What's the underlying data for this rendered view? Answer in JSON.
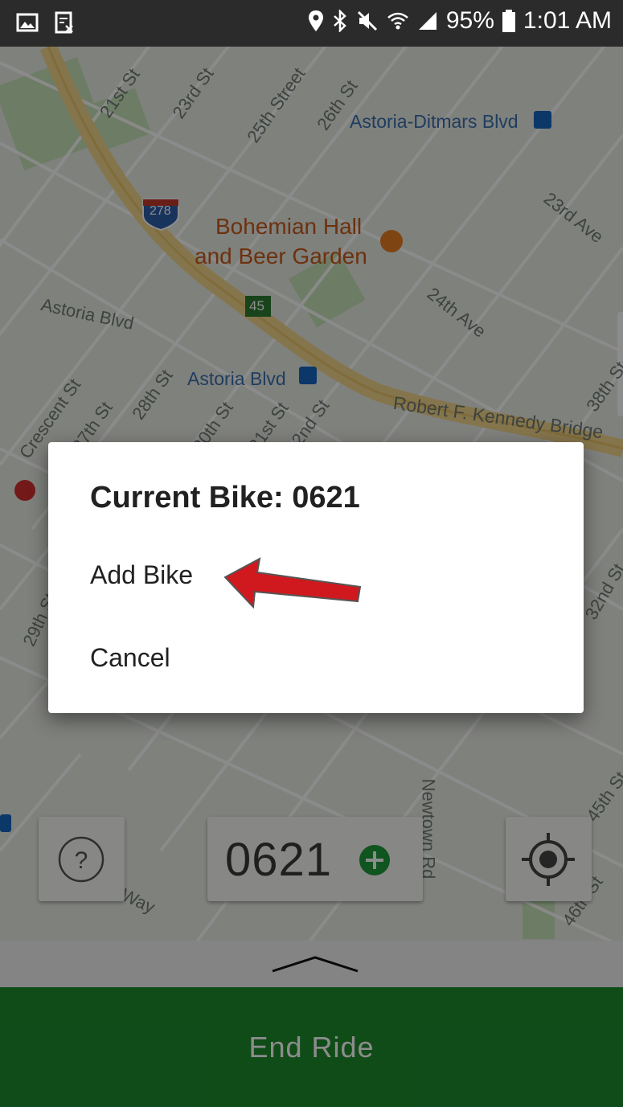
{
  "status_bar": {
    "battery": "95%",
    "time": "1:01 AM"
  },
  "map": {
    "labels": {
      "st21": "21st St",
      "st23": "23rd St",
      "street25": "25th Street",
      "st26": "26th St",
      "ditmars": "Astoria-Ditmars Blvd",
      "ave23": "23rd Ave",
      "interstate": "278",
      "bohemian_line1": "Bohemian Hall",
      "bohemian_line2": "and Beer Garden",
      "exit": "45",
      "astoria_blvd_road": "Astoria Blvd",
      "ave24": "24th Ave",
      "st38": "38th St",
      "crescent": "Crescent St",
      "st27": "27th St",
      "st28": "28th St",
      "astoria_blvd_station": "Astoria Blvd",
      "st30": "30th St",
      "st31": "31st St",
      "st32": "32nd St",
      "rfk": "Robert F. Kennedy Bridge",
      "st29": "29th St",
      "st32b": "32nd St",
      "newtown": "Newtown Rd",
      "st45": "45th St",
      "st46": "46th St",
      "way": "Way"
    }
  },
  "controls": {
    "bike_number": "0621"
  },
  "dialog": {
    "title": "Current Bike: 0621",
    "items": [
      {
        "label": "Add Bike"
      },
      {
        "label": "Cancel"
      }
    ]
  },
  "end_ride": {
    "label": "End Ride"
  },
  "colors": {
    "accent_green": "#1e8a2d",
    "arrow_red": "#d0191e"
  }
}
